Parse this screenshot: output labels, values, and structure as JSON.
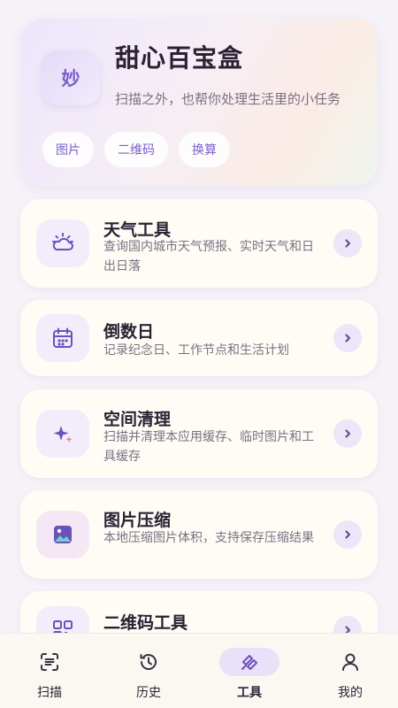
{
  "hero": {
    "avatar_char": "妙",
    "title": "甜心百宝盒",
    "subtitle": "扫描之外，也帮你处理生活里的小任务",
    "chips": [
      "图片",
      "二维码",
      "换算"
    ]
  },
  "tools": [
    {
      "title": "天气工具",
      "desc": "查询国内城市天气预报、实时天气和日出日落",
      "icon": "sun-cloud-icon"
    },
    {
      "title": "倒数日",
      "desc": "记录纪念日、工作节点和生活计划",
      "icon": "calendar-icon"
    },
    {
      "title": "空间清理",
      "desc": "扫描并清理本应用缓存、临时图片和工具缓存",
      "icon": "sparkle-icon"
    },
    {
      "title": "图片压缩",
      "desc": "本地压缩图片体积，支持保存压缩结果",
      "icon": "image-icon"
    },
    {
      "title": "二维码工具",
      "desc": "",
      "icon": "qrcode-icon"
    }
  ],
  "nav": {
    "items": [
      {
        "label": "扫描",
        "icon": "scan-icon"
      },
      {
        "label": "历史",
        "icon": "history-icon"
      },
      {
        "label": "工具",
        "icon": "tools-icon",
        "active": true
      },
      {
        "label": "我的",
        "icon": "profile-icon"
      }
    ]
  },
  "colors": {
    "accent": "#7a5fc8",
    "card_bg": "#fffcf5",
    "page_bg": "#f5f2f8",
    "icon_bg": "#f3ecfa"
  }
}
